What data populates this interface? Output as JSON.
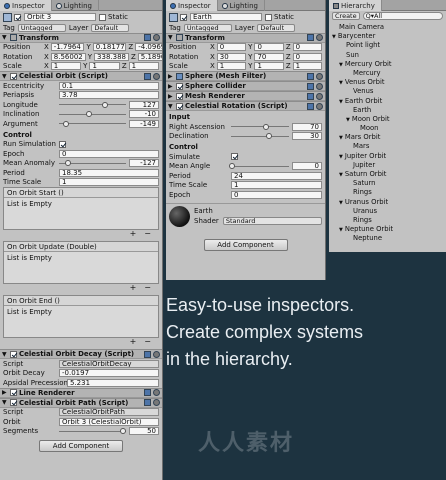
{
  "left_inspector": {
    "tabs": [
      "Inspector",
      "Lighting"
    ],
    "object_name": "Orbit 3",
    "static_label": "Static",
    "tag_label": "Tag",
    "tag_value": "Untagged",
    "layer_label": "Layer",
    "layer_value": "Default",
    "transform": {
      "title": "Transform",
      "position_label": "Position",
      "position": [
        "-1.7964",
        "0.18177",
        "-4.0969"
      ],
      "rotation_label": "Rotation",
      "rotation": [
        "8.56002",
        "338.388",
        "5.18908"
      ],
      "scale_label": "Scale",
      "scale": [
        "1",
        "1",
        "1"
      ]
    },
    "celestial_orbit": {
      "title": "Celestial Orbit (Script)",
      "eccentricity_label": "Eccentricity",
      "eccentricity": "0.1",
      "periapsis_label": "Periapsis",
      "periapsis": "3.78",
      "longitude_label": "Longitude",
      "longitude": "127",
      "longitude_frac": 0.68,
      "inclination_label": "Inclination",
      "inclination": "-10",
      "inclination_frac": 0.45,
      "argument_label": "Argument",
      "argument": "-149",
      "argument_frac": 0.1,
      "control_header": "Control",
      "run_sim_label": "Run Simulation",
      "epoch_label": "Epoch",
      "epoch": "0",
      "mean_anomaly_label": "Mean Anomaly",
      "mean_anomaly": "-127",
      "mean_anomaly_frac": 0.14,
      "period_label": "Period",
      "period": "18.35",
      "time_scale_label": "Time Scale",
      "time_scale": "1",
      "events": [
        {
          "title": "On Orbit Start ()",
          "body": "List is Empty"
        },
        {
          "title": "On Orbit Update (Double)",
          "body": "List is Empty"
        },
        {
          "title": "On Orbit End ()",
          "body": "List is Empty"
        }
      ]
    },
    "decay": {
      "title": "Celestial Orbit Decay (Script)",
      "script_label": "Script",
      "script": "CelestialOrbitDecay",
      "orbit_decay_label": "Orbit Decay",
      "orbit_decay": "-0.0197",
      "apsidal_label": "Apsidal Precession",
      "apsidal": "5.231"
    },
    "line_renderer": {
      "title": "Line Renderer"
    },
    "path": {
      "title": "Celestial Orbit Path (Script)",
      "script_label": "Script",
      "script": "CelestialOrbitPath",
      "orbit_label": "Orbit",
      "orbit": "Orbit 3 (CelestialOrbit)",
      "segments_label": "Segments",
      "segments": "50",
      "segments_frac": 0.95
    },
    "add_component": "Add Component"
  },
  "right_inspector": {
    "tabs": [
      "Inspector",
      "Lighting"
    ],
    "object_name": "Earth",
    "static_label": "Static",
    "tag_label": "Tag",
    "tag_value": "Untagged",
    "layer_label": "Layer",
    "layer_value": "Default",
    "transform": {
      "title": "Transform",
      "position_label": "Position",
      "position": [
        "0",
        "0",
        "0"
      ],
      "rotation_label": "Rotation",
      "rotation": [
        "30",
        "70",
        "0"
      ],
      "scale_label": "Scale",
      "scale": [
        "1",
        "1",
        "1"
      ]
    },
    "sphere_filter": "Sphere (Mesh Filter)",
    "sphere_collider": "Sphere Collider",
    "mesh_renderer": "Mesh Renderer",
    "rotation": {
      "title": "Celestial Rotation (Script)",
      "input_header": "Input",
      "right_ascension_label": "Right Ascension",
      "right_ascension": "70",
      "right_ascension_frac": 0.6,
      "declination_label": "Declination",
      "declination": "30",
      "declination_frac": 0.65,
      "control_header": "Control",
      "simulate_label": "Simulate",
      "mean_angle_label": "Mean Angle",
      "mean_angle": "0",
      "mean_angle_frac": 0.02,
      "period_label": "Period",
      "period": "24",
      "time_scale_label": "Time Scale",
      "time_scale": "1",
      "epoch_label": "Epoch",
      "epoch": "0"
    },
    "material": {
      "name": "Earth",
      "shader_label": "Shader",
      "shader": "Standard"
    },
    "add_component": "Add Component"
  },
  "hierarchy": {
    "tab": "Hierarchy",
    "create_label": "Create",
    "search_placeholder": "Q▾All",
    "items": [
      {
        "label": "Main Camera",
        "indent": 0,
        "arrow": ""
      },
      {
        "label": "Barycenter",
        "indent": 0,
        "arrow": "▼"
      },
      {
        "label": "Point light",
        "indent": 1,
        "arrow": ""
      },
      {
        "label": "Sun",
        "indent": 1,
        "arrow": ""
      },
      {
        "label": "Mercury Orbit",
        "indent": 1,
        "arrow": "▼"
      },
      {
        "label": "Mercury",
        "indent": 2,
        "arrow": ""
      },
      {
        "label": "Venus Orbit",
        "indent": 1,
        "arrow": "▼"
      },
      {
        "label": "Venus",
        "indent": 2,
        "arrow": ""
      },
      {
        "label": "Earth Orbit",
        "indent": 1,
        "arrow": "▼"
      },
      {
        "label": "Earth",
        "indent": 2,
        "arrow": ""
      },
      {
        "label": "Moon Orbit",
        "indent": 2,
        "arrow": "▼"
      },
      {
        "label": "Moon",
        "indent": 3,
        "arrow": ""
      },
      {
        "label": "Mars Orbit",
        "indent": 1,
        "arrow": "▼"
      },
      {
        "label": "Mars",
        "indent": 2,
        "arrow": ""
      },
      {
        "label": "Jupiter Orbit",
        "indent": 1,
        "arrow": "▼"
      },
      {
        "label": "Jupiter",
        "indent": 2,
        "arrow": ""
      },
      {
        "label": "Saturn Orbit",
        "indent": 1,
        "arrow": "▼"
      },
      {
        "label": "Saturn",
        "indent": 2,
        "arrow": ""
      },
      {
        "label": "Rings",
        "indent": 2,
        "arrow": ""
      },
      {
        "label": "Uranus Orbit",
        "indent": 1,
        "arrow": "▼"
      },
      {
        "label": "Uranus",
        "indent": 2,
        "arrow": ""
      },
      {
        "label": "Rings",
        "indent": 2,
        "arrow": ""
      },
      {
        "label": "Neptune Orbit",
        "indent": 1,
        "arrow": "▼"
      },
      {
        "label": "Neptune",
        "indent": 2,
        "arrow": ""
      }
    ]
  },
  "promo": {
    "line1": "Easy-to-use inspectors.",
    "line2": "Create complex systems",
    "line3": "in the hierarchy."
  },
  "watermark": "人人素材"
}
